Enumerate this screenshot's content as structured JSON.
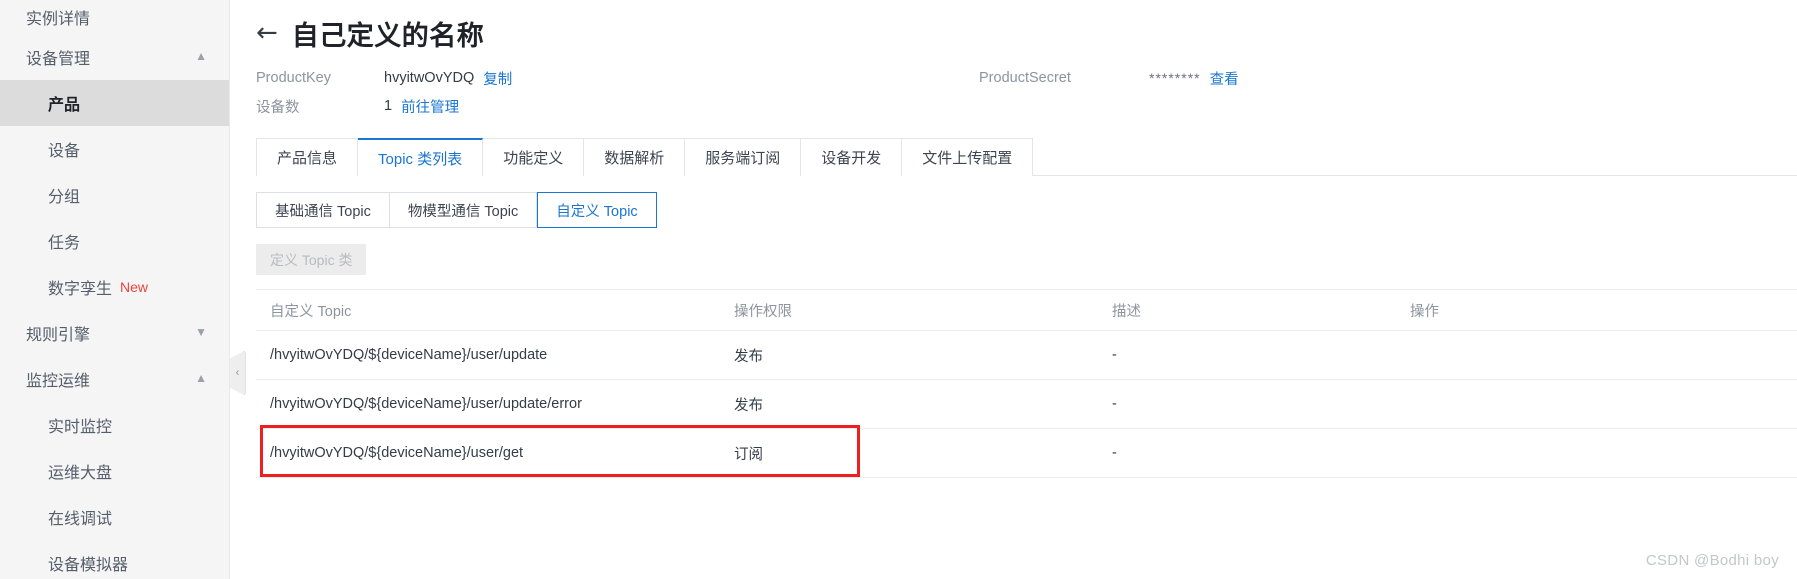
{
  "sidebar": {
    "top_item": {
      "label": "实例详情"
    },
    "groups": [
      {
        "label": "设备管理",
        "caret": "chevron-up",
        "items": [
          {
            "label": "产品",
            "active": true
          },
          {
            "label": "设备",
            "active": false
          },
          {
            "label": "分组",
            "active": false
          },
          {
            "label": "任务",
            "active": false
          },
          {
            "label": "数字孪生",
            "badge": "New",
            "active": false
          }
        ]
      },
      {
        "label": "规则引擎",
        "caret": "chevron-down",
        "items": []
      },
      {
        "label": "监控运维",
        "caret": "chevron-up",
        "items": [
          {
            "label": "实时监控",
            "active": false
          },
          {
            "label": "运维大盘",
            "active": false
          },
          {
            "label": "在线调试",
            "active": false
          },
          {
            "label": "设备模拟器",
            "active": false
          }
        ]
      }
    ],
    "collapse_handle": "‹"
  },
  "header": {
    "back_arrow": "←",
    "title": "自己定义的名称",
    "product_key_label": "ProductKey",
    "product_key_value": "hvyitwOvYDQ",
    "copy_label": "复制",
    "device_count_label": "设备数",
    "device_count_value": "1",
    "goto_manage_label": "前往管理",
    "product_secret_label": "ProductSecret",
    "product_secret_value": "********",
    "view_label": "查看"
  },
  "tabs": [
    {
      "label": "产品信息",
      "active": false
    },
    {
      "label": "Topic 类列表",
      "active": true
    },
    {
      "label": "功能定义",
      "active": false
    },
    {
      "label": "数据解析",
      "active": false
    },
    {
      "label": "服务端订阅",
      "active": false
    },
    {
      "label": "设备开发",
      "active": false
    },
    {
      "label": "文件上传配置",
      "active": false
    }
  ],
  "subtabs": [
    {
      "label": "基础通信 Topic",
      "active": false
    },
    {
      "label": "物模型通信 Topic",
      "active": false
    },
    {
      "label": "自定义 Topic",
      "active": true
    }
  ],
  "toolbar": {
    "define_topic_button": "定义 Topic 类"
  },
  "table": {
    "columns": [
      "自定义 Topic",
      "操作权限",
      "描述",
      "操作"
    ],
    "rows": [
      {
        "topic": "/hvyitwOvYDQ/${deviceName}/user/update",
        "permission": "发布",
        "description": "-",
        "action": "",
        "highlighted": false
      },
      {
        "topic": "/hvyitwOvYDQ/${deviceName}/user/update/error",
        "permission": "发布",
        "description": "-",
        "action": "",
        "highlighted": false
      },
      {
        "topic": "/hvyitwOvYDQ/${deviceName}/user/get",
        "permission": "订阅",
        "description": "-",
        "action": "",
        "highlighted": true
      }
    ]
  },
  "watermark": {
    "text": "CSDN @Bodhi boy"
  },
  "colors": {
    "accent": "#1a76d2",
    "highlight": "#f01f1f",
    "new_badge": "#e8453c",
    "sidebar_bg": "#f5f5f5",
    "active_item_bg": "#dcdcdc"
  }
}
